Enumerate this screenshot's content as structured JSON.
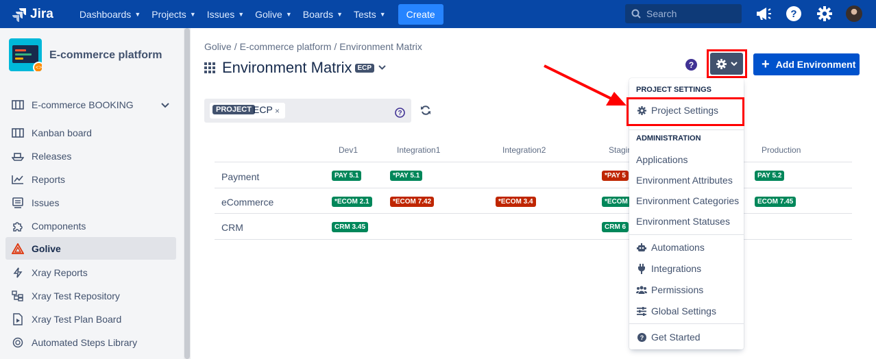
{
  "topnav": {
    "logo": "Jira",
    "items": [
      "Dashboards",
      "Projects",
      "Issues",
      "Golive",
      "Boards",
      "Tests"
    ],
    "create": "Create",
    "search_placeholder": "Search"
  },
  "sidebar": {
    "project_name": "E-commerce platform",
    "board_selector": "E-commerce BOOKING",
    "items": [
      {
        "label": "Kanban board",
        "icon": "kanban-icon"
      },
      {
        "label": "Releases",
        "icon": "ship-icon"
      },
      {
        "label": "Reports",
        "icon": "chart-icon"
      },
      {
        "label": "Issues",
        "icon": "issues-icon"
      },
      {
        "label": "Components",
        "icon": "puzzle-icon"
      },
      {
        "label": "Golive",
        "icon": "golive-icon"
      },
      {
        "label": "Xray Reports",
        "icon": "xray-bolt-icon"
      },
      {
        "label": "Xray Test Repository",
        "icon": "repository-icon"
      },
      {
        "label": "Xray Test Plan Board",
        "icon": "plan-board-icon"
      },
      {
        "label": "Automated Steps Library",
        "icon": "library-icon"
      }
    ]
  },
  "breadcrumb": [
    "Golive",
    "/",
    "E-commerce platform",
    "/",
    "Environment Matrix"
  ],
  "page": {
    "title": "Environment Matrix",
    "project_key": "ECP",
    "add_button": "Add Environment"
  },
  "filter": {
    "label": "PROJECT",
    "value": "ECP",
    "remove": "×"
  },
  "matrix": {
    "columns": [
      "Dev1",
      "Integration1",
      "Integration2",
      "Stagin",
      "Production"
    ],
    "rows": [
      {
        "name": "Payment",
        "dev1": "PAY 5.1",
        "int1": "*PAY 5.1",
        "staging": "*PAY 5",
        "prod": "PAY 5.2"
      },
      {
        "name": "eCommerce",
        "dev1": "*ECOM 2.1",
        "int1": "*ECOM 7.42",
        "int2": "*ECOM 3.4",
        "staging": "*ECOM",
        "prod": "ECOM 7.45"
      },
      {
        "name": "CRM",
        "dev1": "CRM 3.45",
        "staging": "CRM 6"
      }
    ]
  },
  "menu": {
    "project_settings_header": "PROJECT SETTINGS",
    "project_settings": "Project Settings",
    "admin_header": "ADMINISTRATION",
    "admin_items": [
      "Applications",
      "Environment Attributes",
      "Environment Categories",
      "Environment Statuses"
    ],
    "automations": "Automations",
    "integrations": "Integrations",
    "permissions": "Permissions",
    "global_settings": "Global Settings",
    "get_started": "Get Started"
  },
  "colors": {
    "nav": "#0747a6",
    "green_lozenge": "#00875a",
    "red_lozenge": "#bf2600",
    "highlight": "#ff0000"
  }
}
